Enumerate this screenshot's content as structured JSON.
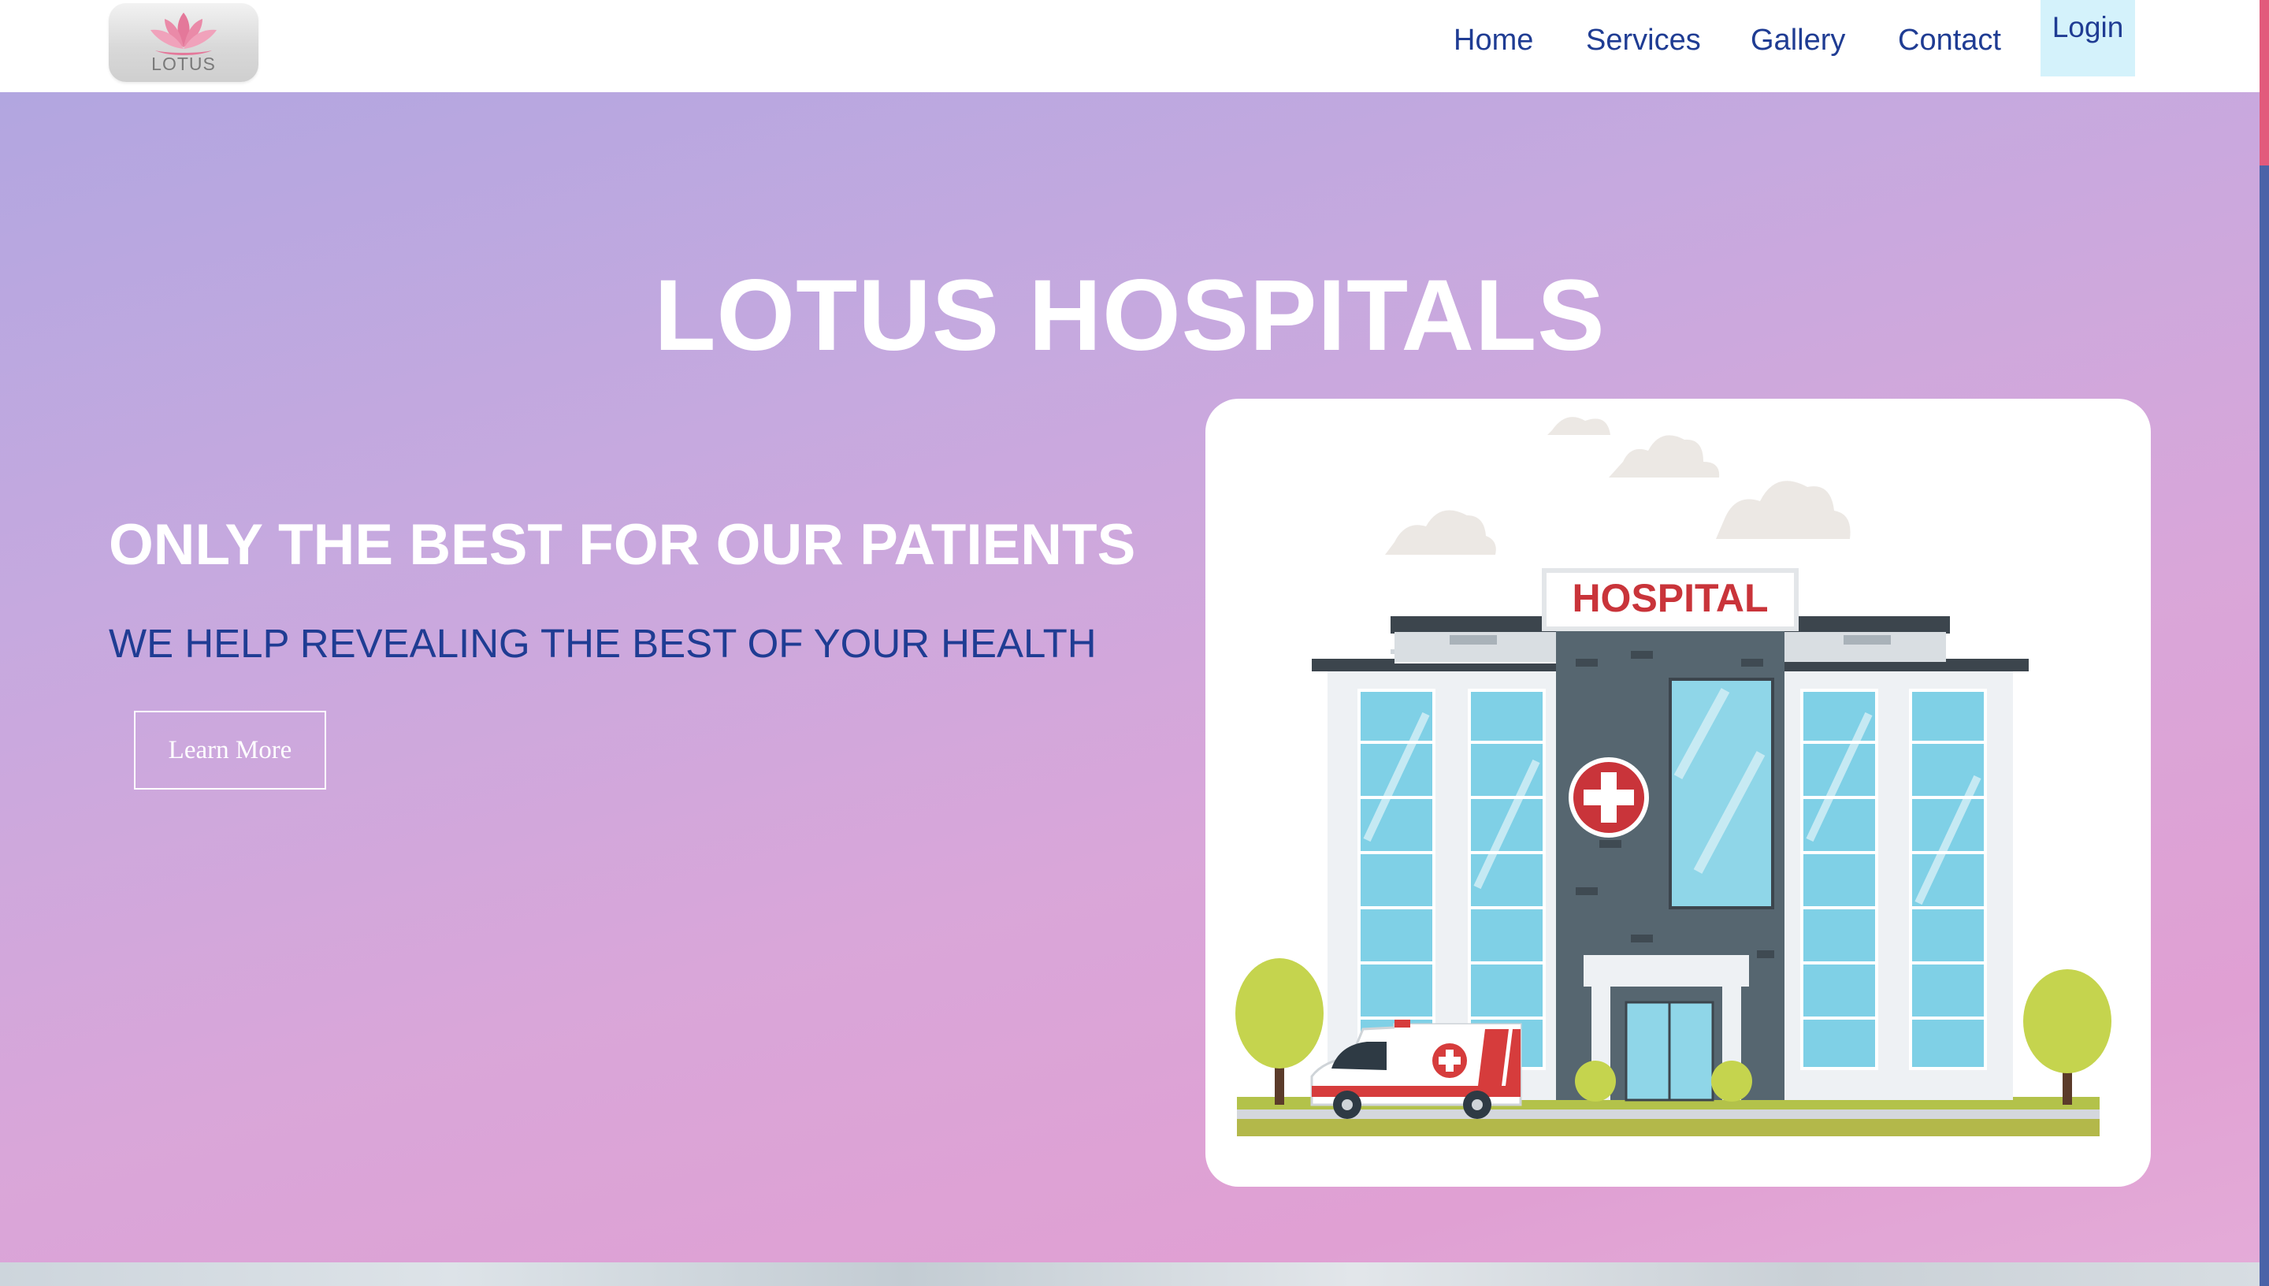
{
  "brand": {
    "logo_text": "LOTUS"
  },
  "nav": {
    "links": [
      {
        "label": "Home"
      },
      {
        "label": "Services"
      },
      {
        "label": "Gallery"
      },
      {
        "label": "Contact"
      }
    ],
    "login_label": "Login"
  },
  "hero": {
    "title": "LOTUS HOSPITALS",
    "subtitle": "ONLY THE BEST FOR OUR PATIENTS",
    "tagline": "WE HELP REVEALING THE BEST OF YOUR HEALTH",
    "cta_label": "Learn More",
    "illustration_sign": "HOSPITAL"
  },
  "colors": {
    "nav_link": "#1f3c93",
    "login_bg": "#d4f2fb",
    "hero_gradient_start": "#b2a6e0",
    "hero_gradient_end": "#e4abd8",
    "hospital_red": "#c9343a",
    "scroll_thumb": "#e25a7c"
  }
}
